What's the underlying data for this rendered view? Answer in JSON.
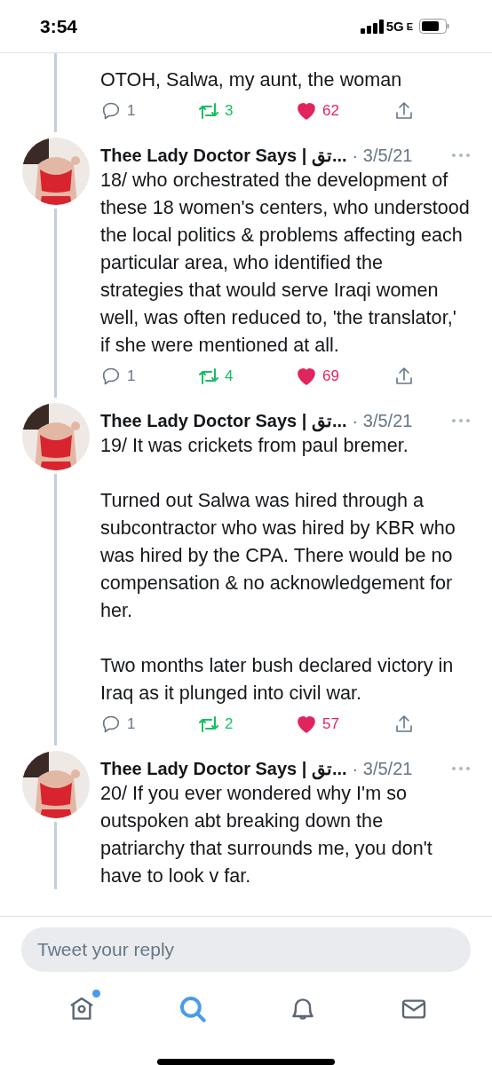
{
  "status_bar": {
    "time": "3:54",
    "network": "5G",
    "network_suffix": "E"
  },
  "partial_tweet": {
    "text": "OTOH, Salwa, my aunt, the woman",
    "replies": "1",
    "retweets": "3",
    "likes": "62",
    "retweeted": true,
    "liked": true
  },
  "tweets": [
    {
      "author": "Thee Lady Doctor Says | تق...",
      "date": "· 3/5/21",
      "text": "18/ who orchestrated the development of these 18 women's centers, who understood the local politics & problems affecting each particular area, who identified the strategies that would serve Iraqi women well, was often reduced to, 'the translator,' if she were mentioned at all.",
      "replies": "1",
      "retweets": "4",
      "likes": "69",
      "retweeted": true,
      "liked": true,
      "thread_below": true
    },
    {
      "author": "Thee Lady Doctor Says | تق...",
      "date": "· 3/5/21",
      "text": "19/ It was crickets from paul bremer.\n\nTurned out Salwa was hired through a subcontractor who was hired by KBR who was hired by the CPA. There would be no compensation & no acknowledgement for her.\n\nTwo months later bush declared victory in Iraq as it plunged into civil war.",
      "replies": "1",
      "retweets": "2",
      "likes": "57",
      "retweeted": true,
      "liked": true,
      "thread_below": true
    },
    {
      "author": "Thee Lady Doctor Says | تق...",
      "date": "· 3/5/21",
      "text": "20/ If you ever wondered why I'm so outspoken abt breaking down the patriarchy that surrounds me, you don't have to look v far.",
      "thread_below": true
    }
  ],
  "reply_field": {
    "placeholder": "Tweet your reply"
  },
  "nav": [
    {
      "kind": "home",
      "selected": false,
      "badge": true
    },
    {
      "kind": "search",
      "selected": true,
      "badge": false
    },
    {
      "kind": "notifications",
      "selected": false,
      "badge": false
    },
    {
      "kind": "messages",
      "selected": false,
      "badge": false
    }
  ]
}
